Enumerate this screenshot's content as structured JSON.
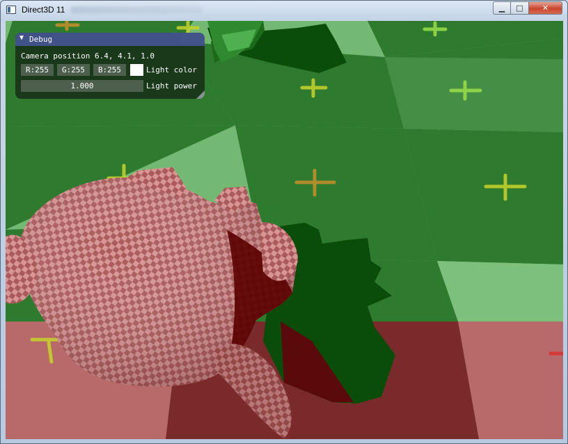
{
  "window": {
    "title": "Direct3D 11",
    "minimize_glyph": "▁",
    "maximize_glyph": "□",
    "close_glyph": "✕"
  },
  "debug": {
    "title": "Debug",
    "collapse_glyph": "▼",
    "camera_text": "Camera position 6.4, 4.1, 1.0",
    "r_value": "R:255",
    "g_value": "G:255",
    "b_value": "B:255",
    "light_color_label": "Light color",
    "light_color_hex": "#ffffff",
    "light_power_value": "1.000",
    "light_power_label": "Light power"
  },
  "scene": {
    "floor_light": "#73b873",
    "floor_dark": "#2e7a2e",
    "red_zone": "#b86a6a",
    "shadow": "#0a4d0a",
    "model_color": "#c97a7a"
  },
  "icons": [
    "app-icon",
    "minimize-icon",
    "maximize-icon",
    "close-icon",
    "collapse-icon",
    "resize-grip-icon"
  ]
}
